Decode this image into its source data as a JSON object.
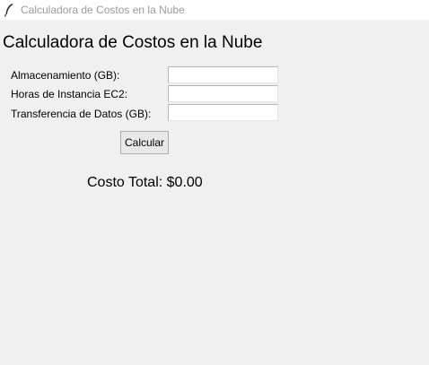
{
  "window": {
    "title": "Calculadora de Costos en la Nube"
  },
  "app": {
    "heading": "Calculadora de Costos en la Nube"
  },
  "form": {
    "storage": {
      "label": "Almacenamiento (GB):",
      "value": ""
    },
    "ec2_hours": {
      "label": "Horas de Instancia EC2:",
      "value": ""
    },
    "data_transfer": {
      "label": "Transferencia de Datos (GB):",
      "value": ""
    },
    "calculate_label": "Calcular"
  },
  "result": {
    "prefix": "Costo Total: ",
    "total": "$0.00"
  }
}
